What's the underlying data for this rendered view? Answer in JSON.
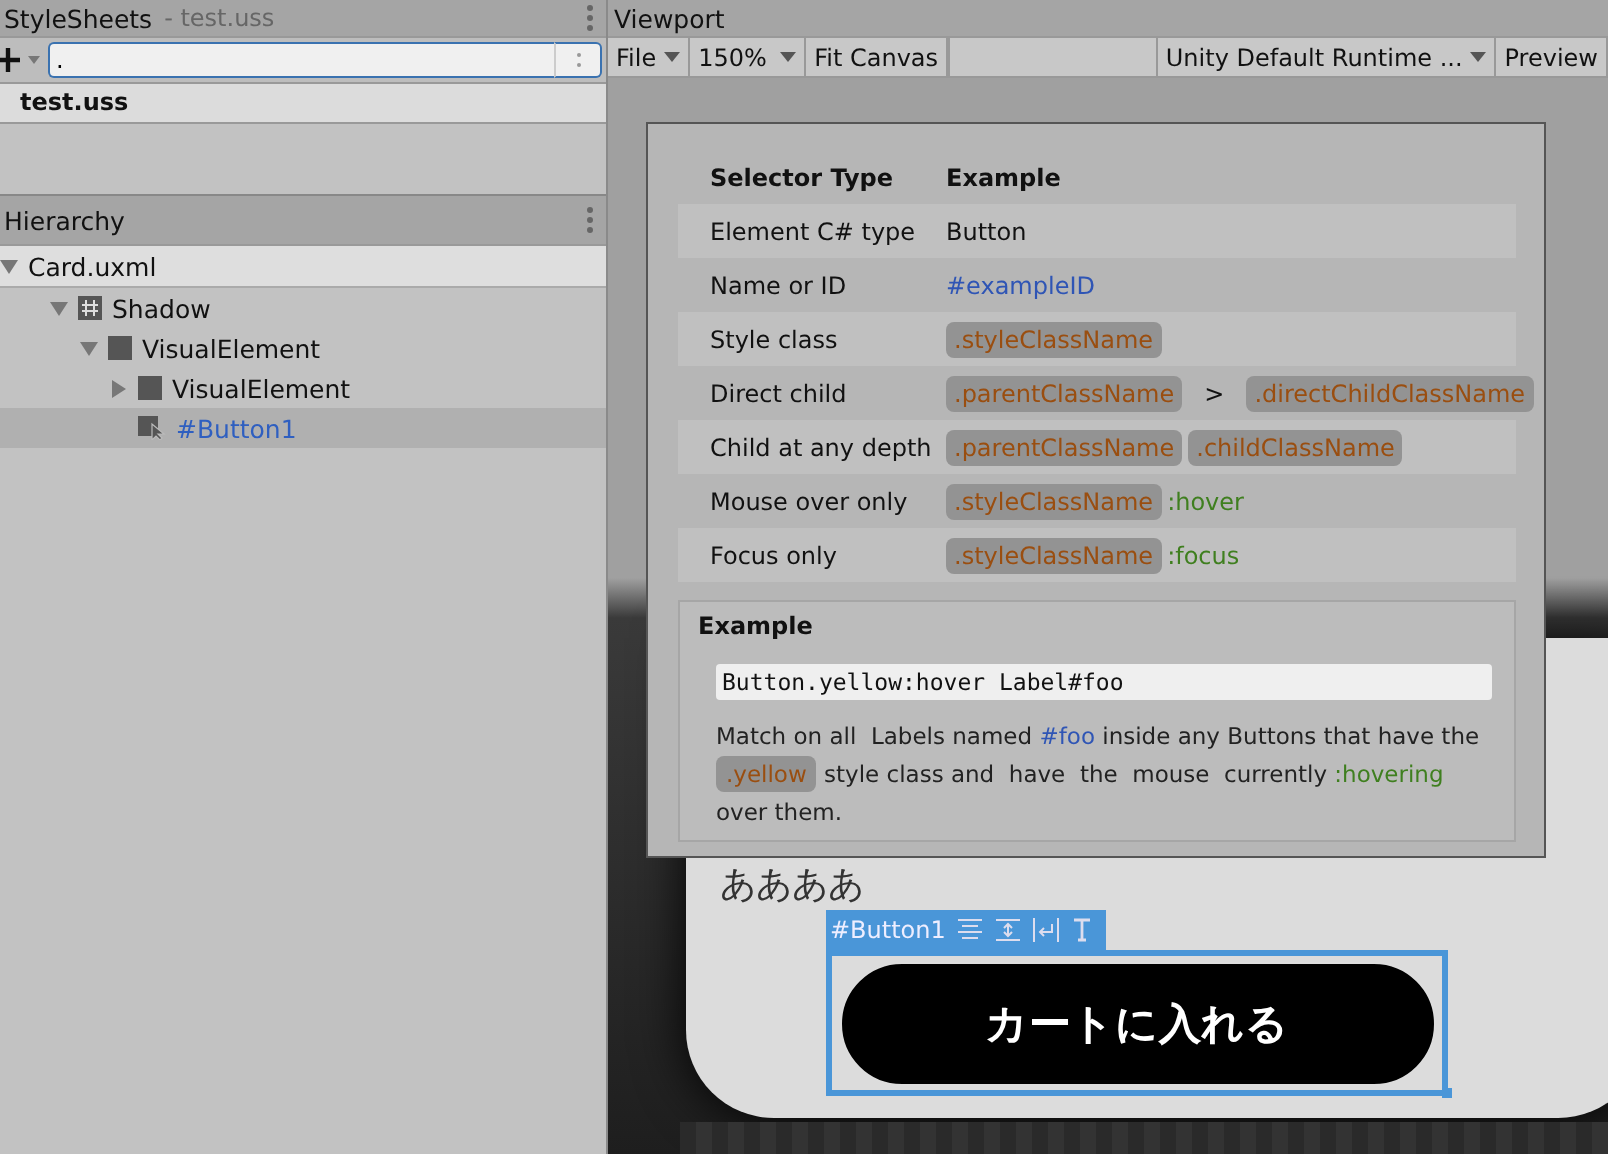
{
  "stylesheets": {
    "title": "StyleSheets",
    "subtitle": "- test.uss",
    "search": {
      "value": "."
    },
    "items": [
      {
        "label": "test.uss",
        "selected": false
      }
    ]
  },
  "hierarchy": {
    "title": "Hierarchy",
    "tree": [
      {
        "label": "Card.uxml",
        "kind": "file",
        "expanded": true,
        "selected": false,
        "children": [
          {
            "label": "Shadow",
            "kind": "hash",
            "expanded": true,
            "selected": false,
            "children": [
              {
                "label": "VisualElement",
                "kind": "element",
                "expanded": true,
                "selected": false,
                "children": [
                  {
                    "label": "VisualElement",
                    "kind": "element",
                    "expanded": false,
                    "selected": false
                  },
                  {
                    "label": "#Button1",
                    "kind": "button",
                    "selected": true
                  }
                ]
              }
            ]
          }
        ]
      }
    ]
  },
  "viewport": {
    "title": "Viewport",
    "toolbar": [
      {
        "label": "File",
        "kind": "menu"
      },
      {
        "label": "150%",
        "kind": "dropdown"
      },
      {
        "label": "Fit Canvas",
        "kind": "button"
      },
      {
        "label": "Unity Default Runtime ...",
        "kind": "dropdown"
      },
      {
        "label": "Preview",
        "kind": "button"
      }
    ],
    "card_text": "ああああ",
    "selection_label": "#Button1",
    "card_button": "カートに入れる"
  },
  "selector_help": {
    "headers": [
      "Selector Type",
      "Example"
    ],
    "rows": [
      {
        "type": "Element C# type",
        "example": [
          {
            "kind": "text",
            "text": "Button"
          }
        ]
      },
      {
        "type": "Name or ID",
        "example": [
          {
            "kind": "id",
            "text": "#exampleID"
          }
        ]
      },
      {
        "type": "Style class",
        "example": [
          {
            "kind": "class",
            "text": ".styleClassName"
          }
        ]
      },
      {
        "type": "Direct child",
        "example": [
          {
            "kind": "class",
            "text": ".parentClassName"
          },
          {
            "kind": "op",
            "text": ">"
          },
          {
            "kind": "class",
            "text": ".directChildClassName"
          }
        ]
      },
      {
        "type": "Child at any depth",
        "example": [
          {
            "kind": "class",
            "text": ".parentClassName"
          },
          {
            "kind": "class",
            "text": ".childClassName"
          }
        ]
      },
      {
        "type": "Mouse over only",
        "example": [
          {
            "kind": "class",
            "text": ".styleClassName"
          },
          {
            "kind": "pseudo",
            "text": ":hover"
          }
        ]
      },
      {
        "type": "Focus only",
        "example": [
          {
            "kind": "class",
            "text": ".styleClassName"
          },
          {
            "kind": "pseudo",
            "text": ":focus"
          }
        ]
      }
    ],
    "example": {
      "title": "Example",
      "code": "Button.yellow:hover Label#foo",
      "description": [
        {
          "kind": "text",
          "text": "Match on all  Labels named "
        },
        {
          "kind": "id",
          "text": "#foo"
        },
        {
          "kind": "text",
          "text": " inside any Buttons that have the "
        },
        {
          "kind": "class",
          "text": ".yellow"
        },
        {
          "kind": "text",
          "text": " style class and  have  the  mouse  currently "
        },
        {
          "kind": "pseudo",
          "text": ":hovering"
        },
        {
          "kind": "text",
          "text": " over them."
        }
      ]
    }
  }
}
